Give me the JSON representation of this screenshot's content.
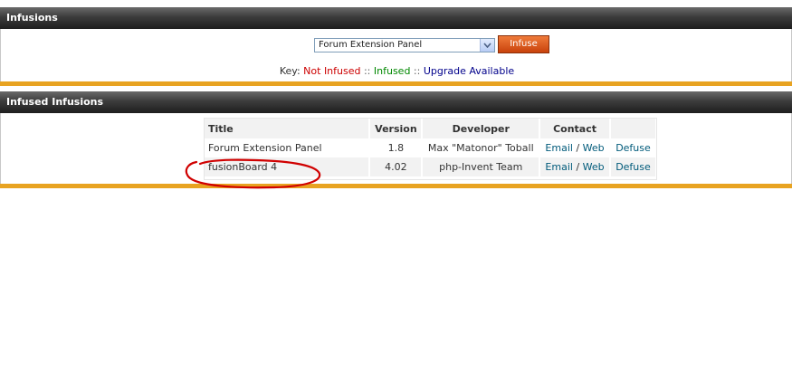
{
  "infusions_panel": {
    "title": "Infusions",
    "select_value": "Forum Extension Panel",
    "infuse_button": "Infuse",
    "key": {
      "prefix": "Key: ",
      "not_infused": "Not Infused",
      "sep": " :: ",
      "infused": "Infused",
      "upgrade": "Upgrade Available"
    }
  },
  "infused_panel": {
    "title": "Infused Infusions",
    "columns": [
      "Title",
      "Version",
      "Developer",
      "Contact",
      ""
    ],
    "rows": [
      {
        "title": "Forum Extension Panel",
        "version": "1.8",
        "developer": "Max \"Matonor\" Toball",
        "email": "Email",
        "slash": "/",
        "web": "Web",
        "action": "Defuse"
      },
      {
        "title": "fusionBoard 4",
        "version": "4.02",
        "developer": "php-Invent Team",
        "email": "Email",
        "slash": "/",
        "web": "Web",
        "action": "Defuse"
      }
    ]
  },
  "annotation": {
    "color": "#d00000"
  },
  "colors": {
    "accent_bar": "#e8a321",
    "button": "#d9561a"
  }
}
